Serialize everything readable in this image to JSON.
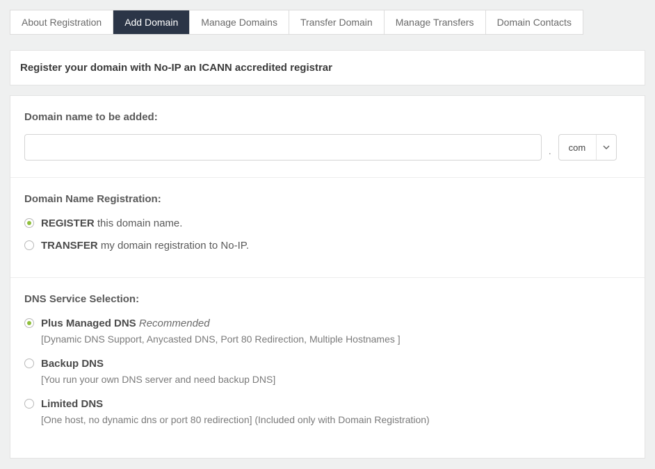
{
  "tabs": {
    "about": "About Registration",
    "add": "Add Domain",
    "manage": "Manage Domains",
    "transfer": "Transfer Domain",
    "manage_transfers": "Manage Transfers",
    "contacts": "Domain Contacts"
  },
  "banner": "Register your domain with No-IP an ICANN accredited registrar",
  "domain": {
    "label": "Domain name to be added:",
    "value": "",
    "tld": "com",
    "dot": "."
  },
  "registration": {
    "label": "Domain Name Registration:",
    "register_strong": "REGISTER",
    "register_rest": " this domain name.",
    "transfer_strong": "TRANSFER",
    "transfer_rest": " my domain registration to No-IP."
  },
  "dns": {
    "label": "DNS Service Selection:",
    "plus_title": "Plus Managed DNS",
    "plus_badge": " Recommended",
    "plus_desc": "[Dynamic DNS Support, Anycasted DNS, Port 80 Redirection, Multiple Hostnames ]",
    "backup_title": "Backup DNS",
    "backup_desc": "[You run your own DNS server and need backup DNS]",
    "limited_title": "Limited DNS",
    "limited_desc": "[One host, no dynamic dns or port 80 redirection] (Included only with Domain Registration)"
  }
}
